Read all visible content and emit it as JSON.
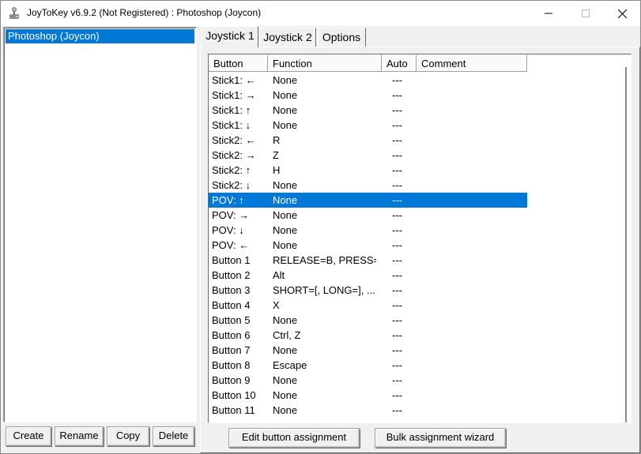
{
  "window": {
    "title": "JoyToKey v6.9.2 (Not Registered) : Photoshop (Joycon)",
    "icons": {
      "app": "joystick-app-icon",
      "minimize": "minimize-icon",
      "maximize": "maximize-icon",
      "close": "close-icon"
    }
  },
  "profiles": {
    "items": [
      "Photoshop (Joycon)"
    ],
    "selected": "Photoshop (Joycon)",
    "buttons": {
      "create": "Create",
      "rename": "Rename",
      "copy": "Copy",
      "delete": "Delete"
    }
  },
  "tabs": [
    "Joystick 1",
    "Joystick 2",
    "Options"
  ],
  "active_tab": "Joystick 1",
  "table": {
    "columns": [
      "Button",
      "Function",
      "Auto",
      "Comment"
    ],
    "rows": [
      {
        "button": "Stick1: ←",
        "function": "None",
        "auto": "---",
        "comment": ""
      },
      {
        "button": "Stick1: →",
        "function": "None",
        "auto": "---",
        "comment": ""
      },
      {
        "button": "Stick1: ↑",
        "function": "None",
        "auto": "---",
        "comment": ""
      },
      {
        "button": "Stick1: ↓",
        "function": "None",
        "auto": "---",
        "comment": ""
      },
      {
        "button": "Stick2: ←",
        "function": "R",
        "auto": "---",
        "comment": ""
      },
      {
        "button": "Stick2: →",
        "function": "Z",
        "auto": "---",
        "comment": ""
      },
      {
        "button": "Stick2: ↑",
        "function": "H",
        "auto": "---",
        "comment": ""
      },
      {
        "button": "Stick2: ↓",
        "function": "None",
        "auto": "---",
        "comment": ""
      },
      {
        "button": "POV: ↑",
        "function": "None",
        "auto": "---",
        "comment": ""
      },
      {
        "button": "POV: →",
        "function": "None",
        "auto": "---",
        "comment": ""
      },
      {
        "button": "POV: ↓",
        "function": "None",
        "auto": "---",
        "comment": ""
      },
      {
        "button": "POV: ←",
        "function": "None",
        "auto": "---",
        "comment": ""
      },
      {
        "button": "Button 1",
        "function": "RELEASE=B, PRESS=E",
        "auto": "---",
        "comment": ""
      },
      {
        "button": "Button 2",
        "function": "Alt",
        "auto": "---",
        "comment": ""
      },
      {
        "button": "Button 3",
        "function": "SHORT=[, LONG=], ...",
        "auto": "---",
        "comment": ""
      },
      {
        "button": "Button 4",
        "function": "X",
        "auto": "---",
        "comment": ""
      },
      {
        "button": "Button 5",
        "function": "None",
        "auto": "---",
        "comment": ""
      },
      {
        "button": "Button 6",
        "function": "Ctrl, Z",
        "auto": "---",
        "comment": ""
      },
      {
        "button": "Button 7",
        "function": "None",
        "auto": "---",
        "comment": ""
      },
      {
        "button": "Button 8",
        "function": "Escape",
        "auto": "---",
        "comment": ""
      },
      {
        "button": "Button 9",
        "function": "None",
        "auto": "---",
        "comment": ""
      },
      {
        "button": "Button 10",
        "function": "None",
        "auto": "---",
        "comment": ""
      },
      {
        "button": "Button 11",
        "function": "None",
        "auto": "---",
        "comment": ""
      }
    ],
    "selected_row": 8
  },
  "actions": {
    "edit": "Edit button assignment",
    "bulk": "Bulk assignment wizard"
  },
  "colors": {
    "selection": "#0078d7",
    "selection_text": "#ffffff",
    "face": "#f0f0f0"
  }
}
